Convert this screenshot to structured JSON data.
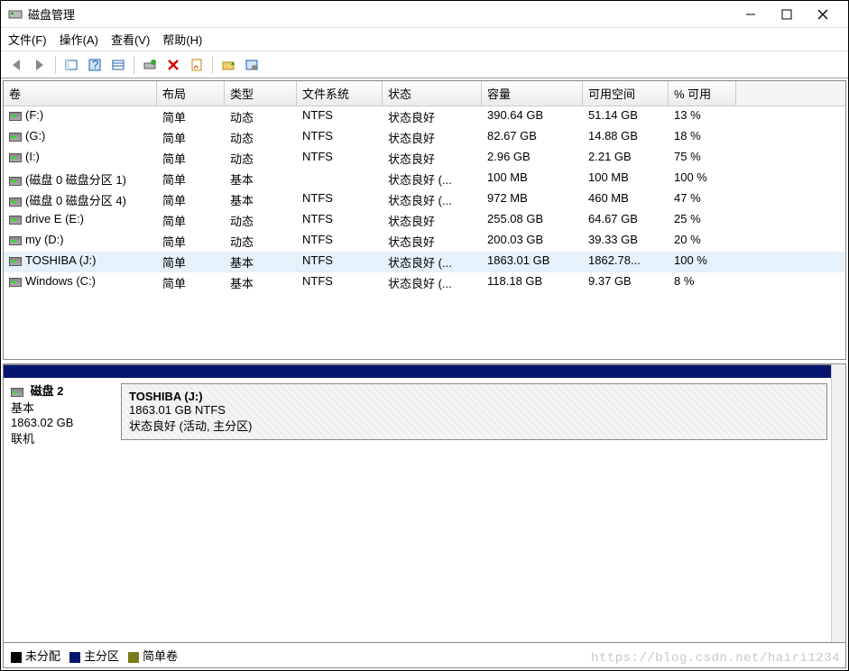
{
  "window": {
    "title": "磁盘管理"
  },
  "menu": {
    "file": "文件(F)",
    "action": "操作(A)",
    "view": "查看(V)",
    "help": "帮助(H)"
  },
  "columns": {
    "volume": "卷",
    "layout": "布局",
    "type": "类型",
    "filesystem": "文件系统",
    "status": "状态",
    "capacity": "容量",
    "free": "可用空间",
    "percent": "% 可用"
  },
  "volumes": [
    {
      "name": "(F:)",
      "layout": "简单",
      "type": "动态",
      "fs": "NTFS",
      "status": "状态良好",
      "capacity": "390.64 GB",
      "free": "51.14 GB",
      "percent": "13 %"
    },
    {
      "name": "(G:)",
      "layout": "简单",
      "type": "动态",
      "fs": "NTFS",
      "status": "状态良好",
      "capacity": "82.67 GB",
      "free": "14.88 GB",
      "percent": "18 %"
    },
    {
      "name": "(I:)",
      "layout": "简单",
      "type": "动态",
      "fs": "NTFS",
      "status": "状态良好",
      "capacity": "2.96 GB",
      "free": "2.21 GB",
      "percent": "75 %"
    },
    {
      "name": "(磁盘 0 磁盘分区 1)",
      "layout": "简单",
      "type": "基本",
      "fs": "",
      "status": "状态良好 (...",
      "capacity": "100 MB",
      "free": "100 MB",
      "percent": "100 %"
    },
    {
      "name": "(磁盘 0 磁盘分区 4)",
      "layout": "简单",
      "type": "基本",
      "fs": "NTFS",
      "status": "状态良好 (...",
      "capacity": "972 MB",
      "free": "460 MB",
      "percent": "47 %"
    },
    {
      "name": "drive E (E:)",
      "layout": "简单",
      "type": "动态",
      "fs": "NTFS",
      "status": "状态良好",
      "capacity": "255.08 GB",
      "free": "64.67 GB",
      "percent": "25 %"
    },
    {
      "name": "my (D:)",
      "layout": "简单",
      "type": "动态",
      "fs": "NTFS",
      "status": "状态良好",
      "capacity": "200.03 GB",
      "free": "39.33 GB",
      "percent": "20 %"
    },
    {
      "name": "TOSHIBA (J:)",
      "layout": "简单",
      "type": "基本",
      "fs": "NTFS",
      "status": "状态良好 (...",
      "capacity": "1863.01 GB",
      "free": "1862.78...",
      "percent": "100 %"
    },
    {
      "name": "Windows (C:)",
      "layout": "简单",
      "type": "基本",
      "fs": "NTFS",
      "status": "状态良好 (...",
      "capacity": "118.18 GB",
      "free": "9.37 GB",
      "percent": "8 %"
    }
  ],
  "selectedVolumeIndex": 7,
  "disk": {
    "label": "磁盘 2",
    "type": "基本",
    "size": "1863.02 GB",
    "status": "联机",
    "partition": {
      "name": "TOSHIBA  (J:)",
      "info": "1863.01 GB NTFS",
      "status": "状态良好 (活动, 主分区)"
    }
  },
  "legend": {
    "unallocated": "未分配",
    "primary": "主分区",
    "simple": "简单卷"
  },
  "watermark": "https://blog.csdn.net/hairi1234"
}
